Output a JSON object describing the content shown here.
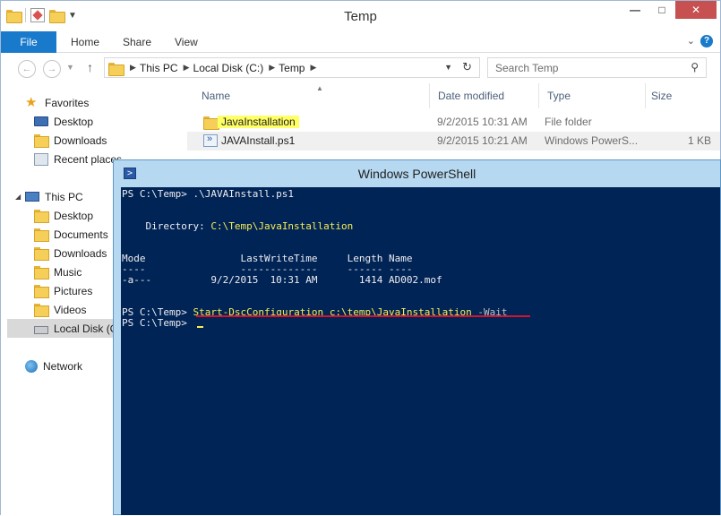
{
  "explorer": {
    "title": "Temp",
    "ribbon": {
      "file": "File",
      "tabs": [
        "Home",
        "Share",
        "View"
      ]
    },
    "address": {
      "segments": [
        "This PC",
        "Local Disk (C:)",
        "Temp"
      ]
    },
    "search_placeholder": "Search Temp",
    "columns": {
      "name": "Name",
      "date": "Date modified",
      "type": "Type",
      "size": "Size"
    },
    "files": [
      {
        "name": "JavaInstallation",
        "date": "9/2/2015 10:31 AM",
        "type": "File folder",
        "size": "",
        "icon": "folder-icon"
      },
      {
        "name": "JAVAInstall.ps1",
        "date": "9/2/2015 10:21 AM",
        "type": "Windows PowerS...",
        "size": "1 KB",
        "icon": "ps1-file-icon"
      }
    ],
    "nav": {
      "favorites": "Favorites",
      "favorites_items": [
        "Desktop",
        "Downloads",
        "Recent places"
      ],
      "this_pc": "This PC",
      "pc_items": [
        "Desktop",
        "Documents",
        "Downloads",
        "Music",
        "Pictures",
        "Videos",
        "Local Disk (C:)"
      ],
      "network": "Network"
    }
  },
  "powershell": {
    "title": "Windows PowerShell",
    "lines": {
      "l1": "PS C:\\Temp> .\\JAVAInstall.ps1",
      "dir_label": "    Directory: ",
      "dir_path": "C:\\Temp\\JavaInstallation",
      "hdr": "Mode                LastWriteTime     Length Name",
      "sep": "----                -------------     ------ ----",
      "row": "-a---          9/2/2015  10:31 AM       1414 AD002.mof",
      "prompt": "PS C:\\Temp> ",
      "cmd": "Start-DscConfiguration ",
      "cmd_path": "c:\\temp\\JavaInstallation",
      "cmd_flag": " -Wait",
      "l_last": "PS C:\\Temp> "
    }
  },
  "colors": {
    "console_bg": "#012456",
    "console_fg": "#eeedf0",
    "console_yellow": "#f7ed53",
    "highlight": "#ffff66",
    "underline": "#d5132b",
    "ribbon_file": "#1979ca"
  }
}
